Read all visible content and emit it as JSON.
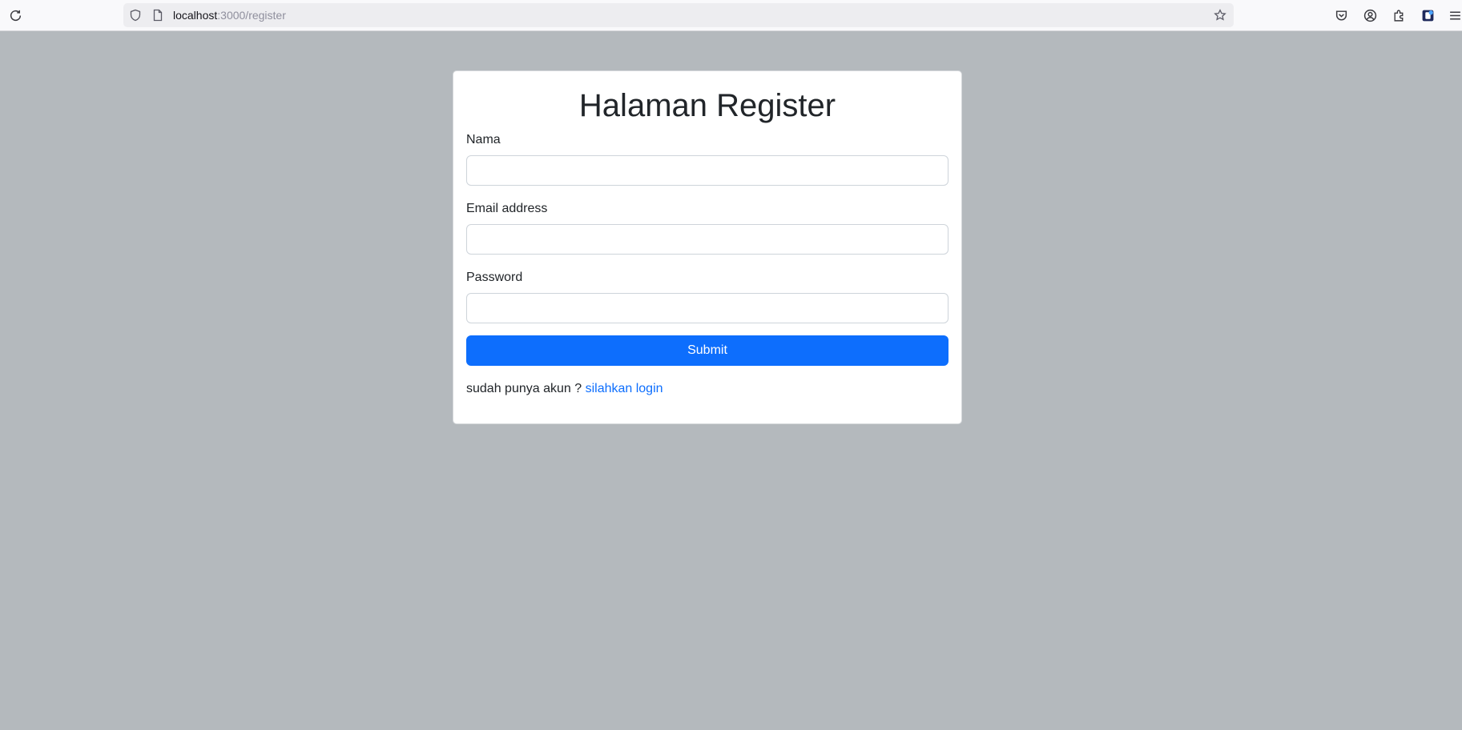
{
  "browser": {
    "url_host": "localhost",
    "url_path": ":3000/register",
    "icons": {
      "reload": "reload-icon",
      "tracking": "shield-icon",
      "page": "page-icon",
      "bookmark": "star-icon",
      "pocket": "pocket-icon",
      "account": "account-icon",
      "extensions": "extensions-icon",
      "extension_active": "extension-app-icon",
      "menu": "hamburger-menu-icon"
    }
  },
  "form": {
    "title": "Halaman Register",
    "name_label": "Nama",
    "name_value": "",
    "email_label": "Email address",
    "email_value": "",
    "password_label": "Password",
    "password_value": "",
    "submit_label": "Submit",
    "footer_text": "sudah punya akun ?",
    "login_link": "silahkan login"
  },
  "colors": {
    "page_background": "#b4b9bd",
    "primary": "#0d6efd"
  }
}
